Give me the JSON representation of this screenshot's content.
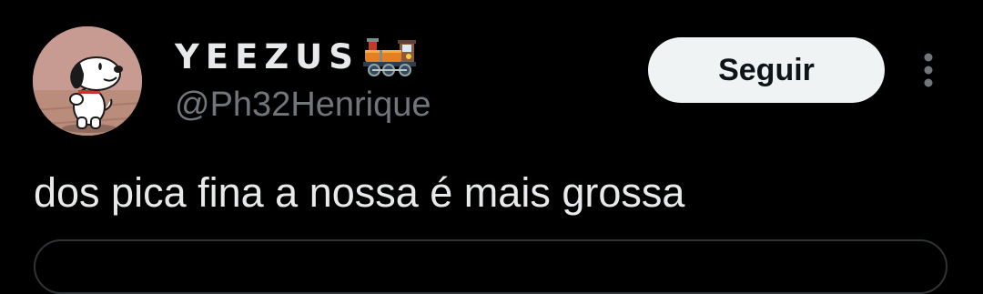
{
  "tweet": {
    "author": {
      "display_name": "YEEZUS",
      "name_emoji": "locomotive-icon",
      "handle": "@Ph32Henrique",
      "avatar": "snoopy-avatar"
    },
    "follow_label": "Seguir",
    "more_icon": "more-vertical-icon",
    "text": "dos pica fina a nossa é mais grossa"
  },
  "colors": {
    "background": "#000000",
    "primary_text": "#e7e9ea",
    "secondary_text": "#71767b",
    "button_bg": "#eff3f4",
    "button_text": "#0f1419",
    "border": "#2f3336"
  }
}
